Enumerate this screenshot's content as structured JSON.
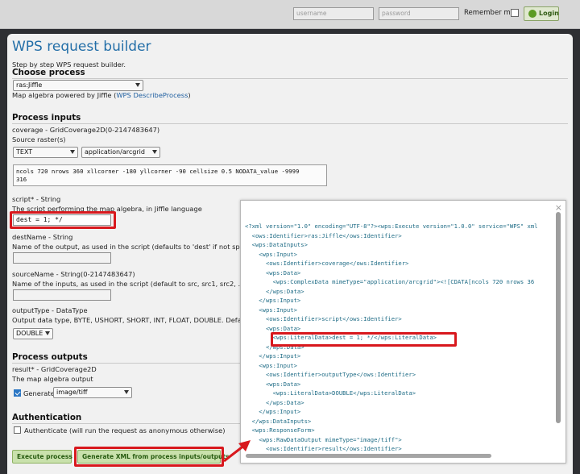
{
  "topbar": {
    "username_placeholder": "username",
    "password_placeholder": "password",
    "remember_label": "Remember me",
    "login_label": "Login"
  },
  "page": {
    "title": "WPS request builder",
    "subtitle": "Step by step WPS request builder."
  },
  "choose": {
    "heading": "Choose process",
    "selected": "ras:Jiffle",
    "desc_prefix": "Map algebra powered by Jiffle (",
    "desc_link": "WPS DescribeProcess",
    "desc_suffix": ")"
  },
  "inputs": {
    "heading": "Process inputs",
    "coverage_label": "coverage - GridCoverage2D(0-2147483647)",
    "coverage_desc": "Source raster(s)",
    "coverage_type": "TEXT",
    "coverage_mime": "application/arcgrid",
    "coverage_value": "ncols 720 nrows 360 xllcorner -180 yllcorner -90 cellsize 0.5 NODATA_value -9999\n316",
    "script_label": "script* - String",
    "script_desc": "The script performing the map algebra, in Jiffle language",
    "script_value": "dest = 1; */",
    "destname_label": "destName - String",
    "destname_desc": "Name of the output, as used in the script (defaults to 'dest' if not specifie",
    "sourcename_label": "sourceName - String(0-2147483647)",
    "sourcename_desc": "Name of the inputs, as used in the script (default to src, src1, src2, ... if n",
    "outputtype_label": "outputType - DataType",
    "outputtype_desc": "Output data type, BYTE, USHORT, SHORT, INT, FLOAT, DOUBLE. Defaults t",
    "outputtype_value": "DOUBLE"
  },
  "outputs": {
    "heading": "Process outputs",
    "result_label": "result* - GridCoverage2D",
    "result_desc": "The map algebra output",
    "generate_label": "Generate",
    "generate_value": "image/tiff"
  },
  "auth": {
    "heading": "Authentication",
    "label": "Authenticate (will run the request as anonymous otherwise)"
  },
  "buttons": {
    "execute": "Execute process",
    "generate_xml": "Generate XML from process inputs/outputs"
  },
  "popup": {
    "close": "×",
    "xml_lines": [
      "<?xml version=\"1.0\" encoding=\"UTF-8\"?><wps:Execute version=\"1.0.0\" service=\"WPS\" xml",
      "  <ows:Identifier>ras:Jiffle</ows:Identifier>",
      "  <wps:DataInputs>",
      "    <wps:Input>",
      "      <ows:Identifier>coverage</ows:Identifier>",
      "      <wps:Data>",
      "        <wps:ComplexData mimeType=\"application/arcgrid\"><![CDATA[ncols 720 nrows 36",
      "      </wps:Data>",
      "    </wps:Input>",
      "    <wps:Input>",
      "      <ows:Identifier>script</ows:Identifier>",
      "      <wps:Data>",
      "        <wps:LiteralData>dest = 1; */</wps:LiteralData>",
      "      </wps:Data>",
      "    </wps:Input>",
      "    <wps:Input>",
      "      <ows:Identifier>outputType</ows:Identifier>",
      "      <wps:Data>",
      "        <wps:LiteralData>DOUBLE</wps:LiteralData>",
      "      </wps:Data>",
      "    </wps:Input>",
      "  </wps:DataInputs>",
      "  <wps:ResponseForm>",
      "    <wps:RawDataOutput mimeType=\"image/tiff\">",
      "      <ows:Identifier>result</ows:Identifier>"
    ]
  },
  "colors": {
    "title": "#246fa8",
    "highlight": "#d8181d",
    "button_bg": "#c9e1ac",
    "xml_text": "#1f6c86"
  }
}
